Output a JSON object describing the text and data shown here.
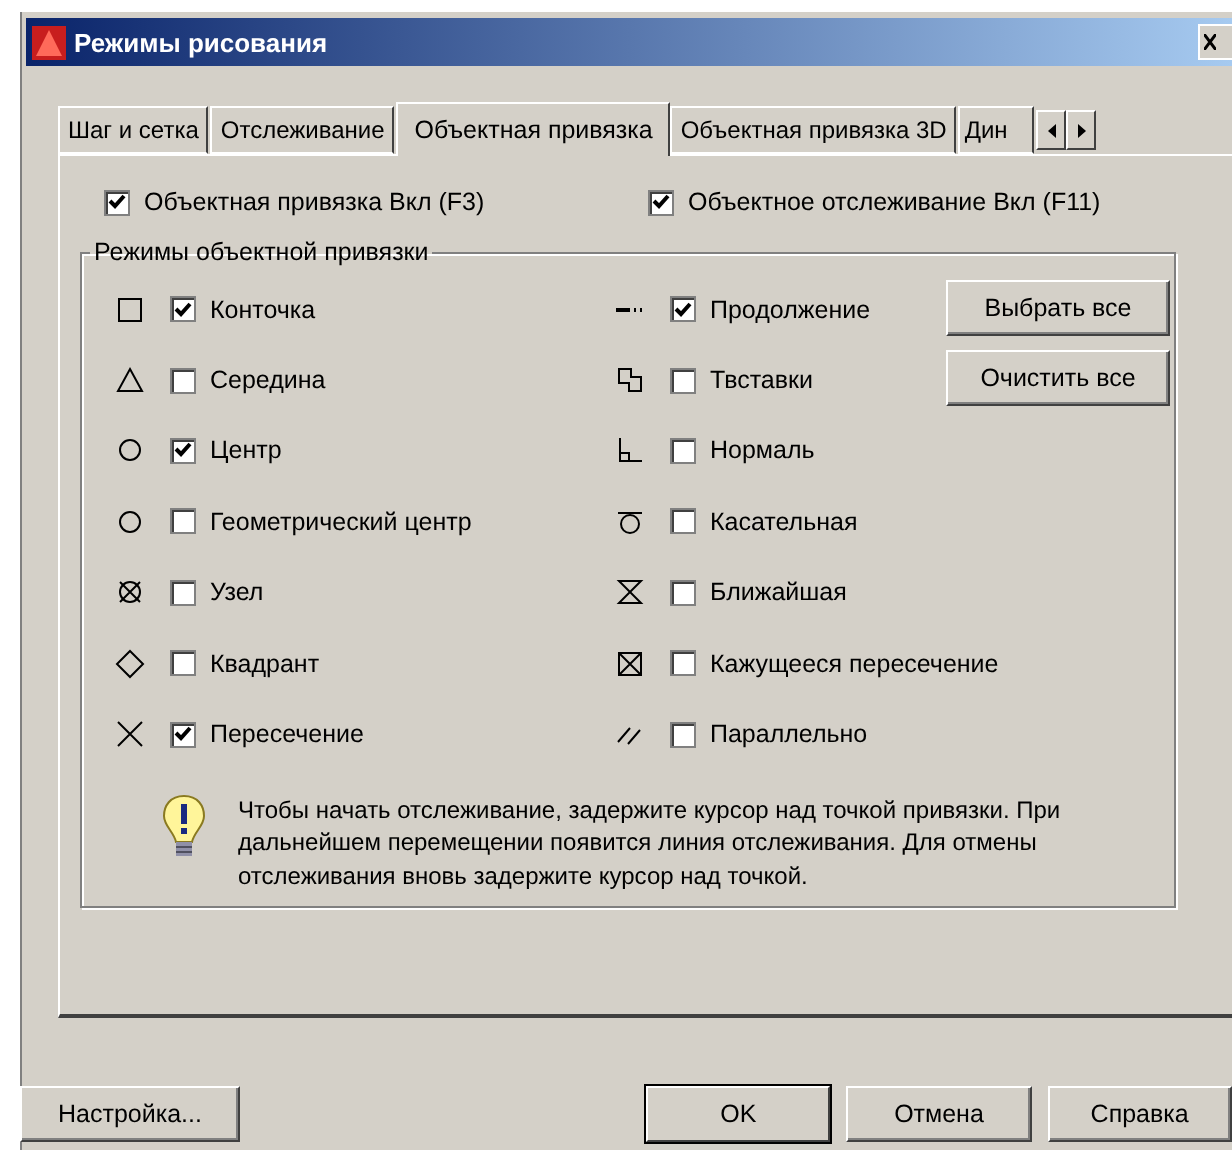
{
  "window": {
    "title": "Режимы рисования"
  },
  "tabs": [
    {
      "label": "Шаг и сетка",
      "selected": false
    },
    {
      "label": "Отслеживание",
      "selected": false
    },
    {
      "label": "Объектная привязка",
      "selected": true
    },
    {
      "label": "Объектная привязка 3D",
      "selected": false
    },
    {
      "label": "Дин",
      "selected": false
    }
  ],
  "toggles": [
    {
      "label": "Объектная привязка Вкл (F3)",
      "checked": true
    },
    {
      "label": "Объектное отслеживание Вкл (F11)",
      "checked": true
    }
  ],
  "group": {
    "title": "Режимы объектной привязки",
    "modes_left": [
      {
        "kind": "square",
        "label": "Конточка",
        "checked": true
      },
      {
        "kind": "triangle",
        "label": "Середина",
        "checked": false
      },
      {
        "kind": "circle",
        "label": "Центр",
        "checked": true
      },
      {
        "kind": "circle",
        "label": "Геометрический центр",
        "checked": false
      },
      {
        "kind": "node",
        "label": "Узел",
        "checked": false
      },
      {
        "kind": "diamond",
        "label": "Квадрант",
        "checked": false
      },
      {
        "kind": "cross",
        "label": "Пересечение",
        "checked": true
      }
    ],
    "modes_right": [
      {
        "kind": "extension",
        "label": "Продолжение",
        "checked": true
      },
      {
        "kind": "insertion",
        "label": "Твставки",
        "checked": false
      },
      {
        "kind": "perpendicular",
        "label": "Нормаль",
        "checked": false
      },
      {
        "kind": "tangent",
        "label": "Касательная",
        "checked": false
      },
      {
        "kind": "nearest",
        "label": "Ближайшая",
        "checked": false
      },
      {
        "kind": "apparent",
        "label": "Кажущееся пересечение",
        "checked": false
      },
      {
        "kind": "parallel",
        "label": "Параллельно",
        "checked": false
      }
    ],
    "buttons": [
      "Выбрать все",
      "Очистить все"
    ],
    "hint": "Чтобы начать отслеживание, задержите курсор над точкой привязки. При дальнейшем перемещении появится линия отслеживания. Для отмены отслеживания вновь задержите курсор над точкой."
  },
  "settings_button": "Настройка...",
  "buttons": [
    "OK",
    "Отмена",
    "Справка"
  ]
}
